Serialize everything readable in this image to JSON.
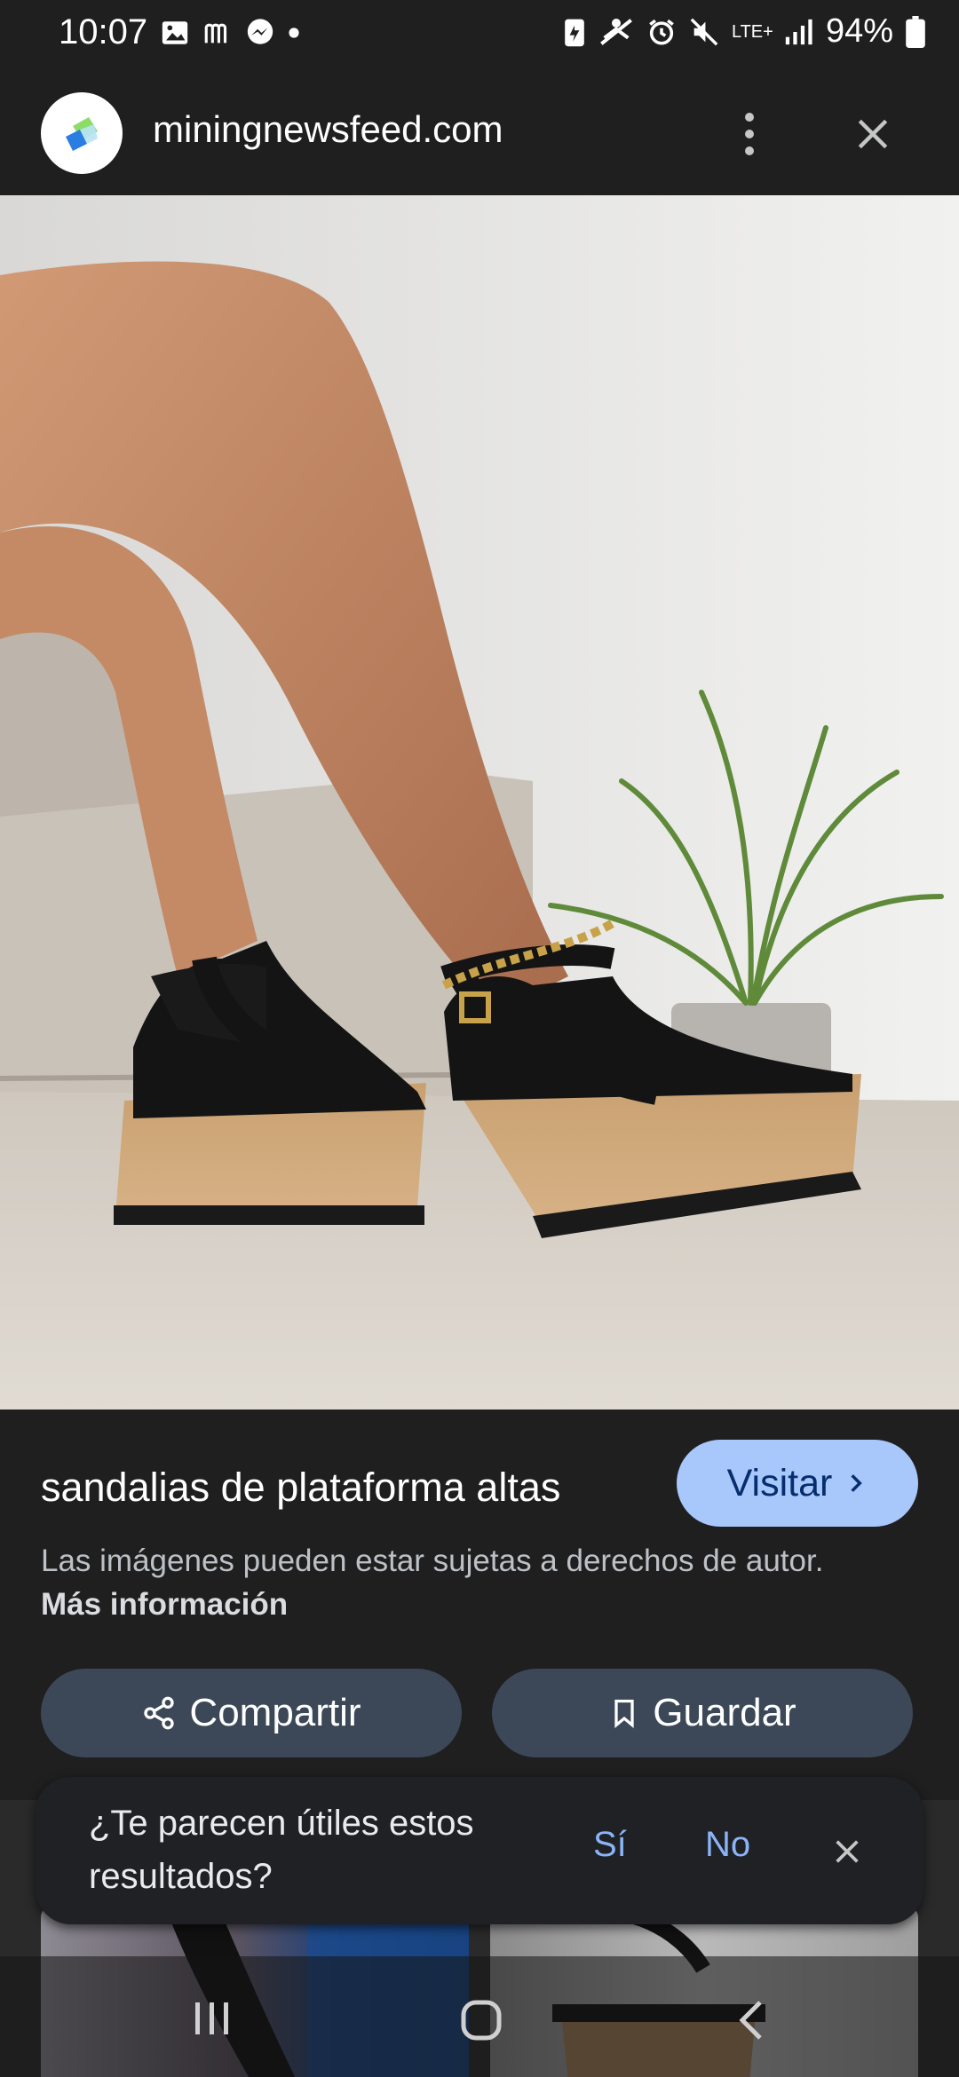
{
  "status_bar": {
    "time": "10:07",
    "network": "LTE+",
    "battery": "94%"
  },
  "header": {
    "domain": "miningnewsfeed.com",
    "logo_icon": "site-logo-icon",
    "more_icon": "more-vert-icon",
    "close_icon": "close-icon"
  },
  "result": {
    "title": "sandalias de plataforma altas",
    "visit_label": "Visitar",
    "copyright_text": "Las imágenes pueden estar sujetas a derechos de autor.",
    "more_info_label": "Más información",
    "share_label": "Compartir",
    "save_label": "Guardar"
  },
  "feedback": {
    "question": "¿Te parecen útiles estos resultados?",
    "yes_label": "Sí",
    "no_label": "No"
  },
  "colors": {
    "accent": "#a8c7fa",
    "link": "#8ab4f8",
    "background": "#1f1f1f",
    "button_bg": "#3c4858"
  }
}
